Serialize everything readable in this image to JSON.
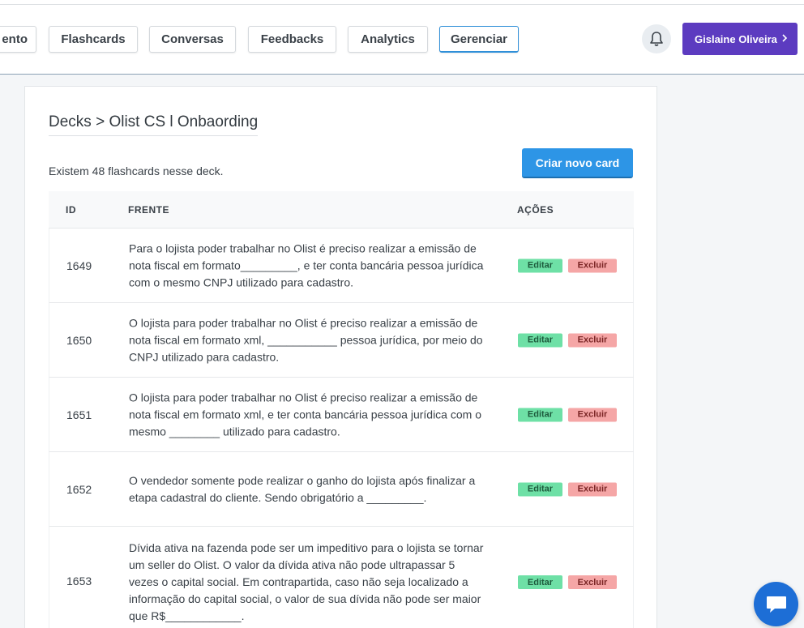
{
  "nav": {
    "tabs": [
      {
        "label": "ento"
      },
      {
        "label": "Flashcards"
      },
      {
        "label": "Conversas"
      },
      {
        "label": "Feedbacks"
      },
      {
        "label": "Analytics"
      },
      {
        "label": "Gerenciar"
      }
    ],
    "active_tab": "Gerenciar",
    "bell_icon": "bell-icon",
    "user": {
      "name": "Gislaine Oliveira",
      "icon": "chevron-right-icon"
    }
  },
  "deck": {
    "breadcrumb": "Decks > Olist CS l Onbaording",
    "count_text": "Existem 48 flashcards nesse deck.",
    "create_label": "Criar novo card"
  },
  "table": {
    "headers": {
      "id": "ID",
      "front": "FRENTE",
      "actions": "AÇÕES"
    },
    "edit_label": "Editar",
    "delete_label": "Excluir",
    "rows": [
      {
        "id": "1649",
        "front": "Para o lojista poder trabalhar no Olist é preciso realizar a emissão de nota fiscal em formato_________, e ter conta bancária pessoa jurídica com o mesmo CNPJ utilizado para cadastro."
      },
      {
        "id": "1650",
        "front": "O lojista para poder trabalhar no Olist é preciso realizar a emissão de nota fiscal em formato xml, ___________ pessoa jurídica, por meio do CNPJ utilizado para cadastro."
      },
      {
        "id": "1651",
        "front": "O lojista para poder trabalhar no Olist é preciso realizar a emissão de nota fiscal em formato xml, e ter conta bancária pessoa jurídica com o mesmo ________ utilizado para cadastro."
      },
      {
        "id": "1652",
        "front": "O vendedor somente pode realizar o ganho do lojista após finalizar a etapa cadastral do cliente. Sendo obrigatório a _________."
      },
      {
        "id": "1653",
        "front": "Dívida ativa na fazenda pode ser um impeditivo para o lojista se tornar um seller do Olist. O valor da dívida ativa não pode ultrapassar 5 vezes o capital social. Em contrapartida, caso não seja localizado a informação do capital social, o valor de sua dívida não pode ser maior que R$____________."
      }
    ]
  },
  "chat_icon": "chat-bubble-icon",
  "colors": {
    "accent_blue": "#2d95e6",
    "user_purple": "#5c3bc0",
    "edit_green": "#6ee0a6",
    "delete_red": "#f5a6a6",
    "chat_blue": "#1d6ed6"
  }
}
